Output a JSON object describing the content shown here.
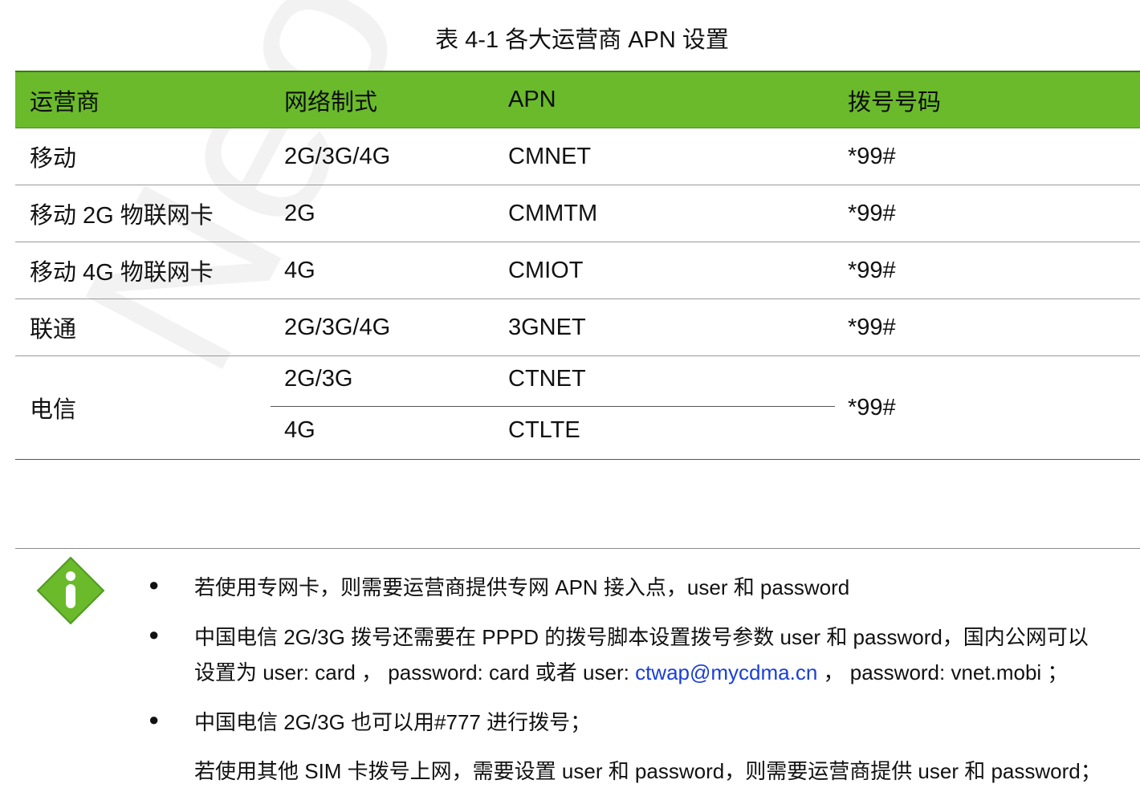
{
  "watermark": "Neoway Confi",
  "caption": "表 4-1 各大运营商 APN 设置",
  "table": {
    "headers": [
      "运营商",
      "网络制式",
      "APN",
      "拨号号码"
    ],
    "rows": [
      [
        "移动",
        "2G/3G/4G",
        "CMNET",
        "*99#"
      ],
      [
        "移动 2G 物联网卡",
        "2G",
        "CMMTM",
        "*99#"
      ],
      [
        "移动 4G 物联网卡",
        "4G",
        "CMIOT",
        "*99#"
      ],
      [
        "联通",
        "2G/3G/4G",
        "3GNET",
        "*99#"
      ]
    ],
    "telecom": {
      "carrier": "电信",
      "net1": "2G/3G",
      "apn1": "CTNET",
      "net2": "4G",
      "apn2": "CTLTE",
      "dial": "*99#"
    }
  },
  "notes": {
    "icon": "info-icon",
    "bullet": "●",
    "n1": "若使用专网卡，则需要运营商提供专网 APN 接入点，user 和 password",
    "n2_line1": "中国电信 2G/3G 拨号还需要在 PPPD 的拨号脚本设置拨号参数 user 和 password，国内公网可以",
    "n2_line2_a": "设置为 user: card ， password: card 或者 user: ",
    "n2_link": "ctwap@mycdma.cn",
    "n2_line2_b": " ， password: vnet.mobi ；",
    "n3": "中国电信 2G/3G 也可以用#777 进行拨号；",
    "n4": "若使用其他 SIM 卡拨号上网，需要设置 user 和 password，则需要运营商提供 user 和 password；"
  },
  "colors": {
    "header_green": "#6aba2b",
    "icon_green": "#6aba2b",
    "link": "#1a3fd6"
  }
}
